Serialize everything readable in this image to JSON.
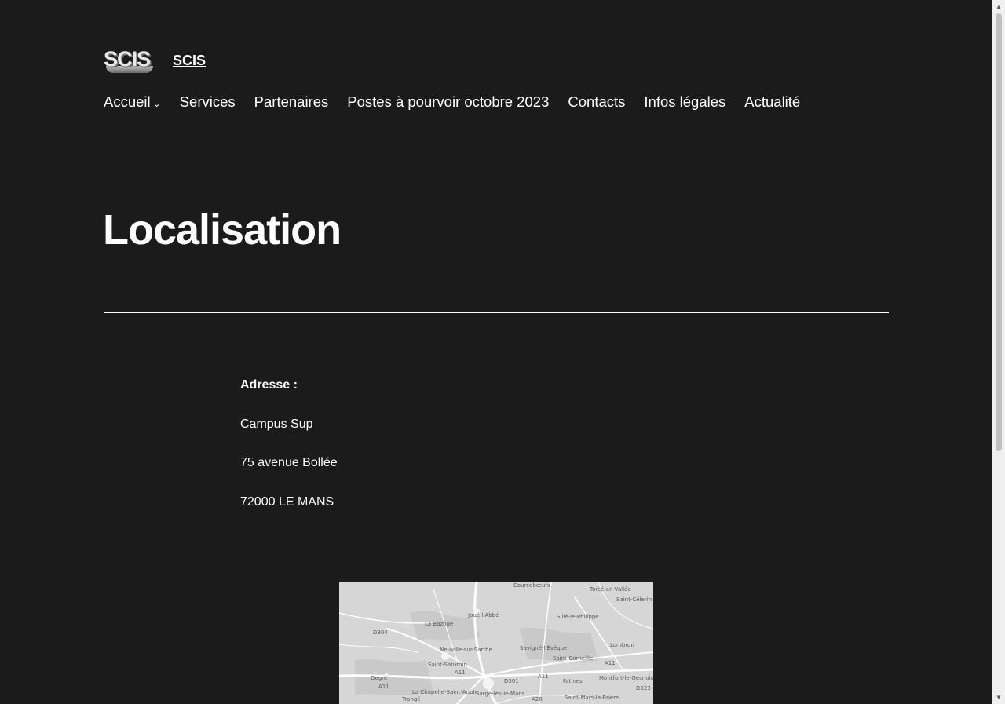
{
  "header": {
    "logo_text": "SCIS",
    "site_title": "SCIS"
  },
  "nav": {
    "items": [
      {
        "label": "Accueil",
        "has_submenu": true
      },
      {
        "label": "Services"
      },
      {
        "label": "Partenaires"
      },
      {
        "label": "Postes à pourvoir octobre 2023"
      },
      {
        "label": "Contacts"
      },
      {
        "label": "Infos légales"
      },
      {
        "label": "Actualité"
      }
    ]
  },
  "main": {
    "title": "Localisation",
    "address": {
      "label": "Adresse :",
      "line1": "Campus Sup",
      "line2": "75 avenue Bollée",
      "line3": "72000 LE MANS"
    }
  },
  "map": {
    "places": [
      "Courcebœufs",
      "Torcé-en-Vallée",
      "Saint-Célerin",
      "Joué-l'Abbé",
      "La Bazoge",
      "Sillé-le-Philippe",
      "Neuville-sur-Sarthe",
      "Savigné-l'Évêque",
      "Lombron",
      "Saint-Saturnin",
      "Saint-Corneille",
      "Degré",
      "Montfort-le-Gesnois",
      "Fatines",
      "La Chapelle-Saint-Aubin",
      "Sargé-lès-le-Mans",
      "Trangé",
      "Saint-Mars-la-Brière"
    ],
    "road_labels": [
      "D304",
      "A11",
      "A11",
      "D301",
      "A11",
      "A28",
      "D323",
      "A11"
    ]
  },
  "colors": {
    "background": "#1b1b1b",
    "text": "#ffffff",
    "map_background": "#d3d3d3"
  }
}
